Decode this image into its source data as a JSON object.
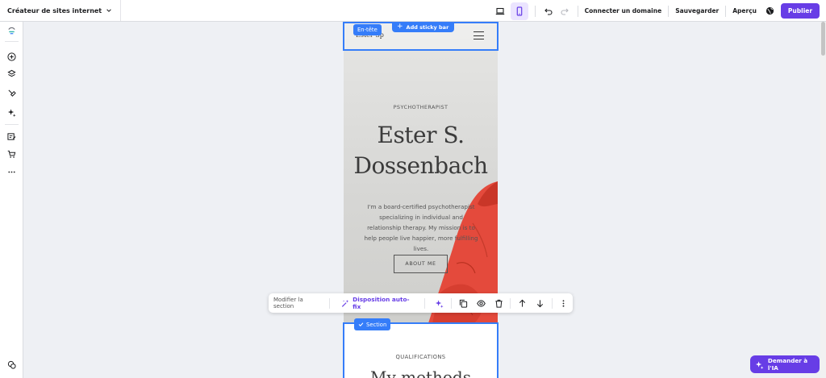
{
  "topbar": {
    "site_builder_label": "Créateur de sites internet",
    "connect_domain": "Connecter un domaine",
    "save": "Sauvegarder",
    "preview": "Aperçu",
    "publish": "Publier"
  },
  "canvas": {
    "header": {
      "logo_text": "Ester Sp"
    },
    "hero": {
      "kicker": "PSYCHOTHERAPIST",
      "name_line1": "Ester S.",
      "name_line2": "Dossenbach",
      "desc_l1": "I'm a board-certified psychotherapist",
      "desc_l2": "specializing in individual and",
      "desc_l3": "relationship therapy. My mission is to",
      "desc_l4": "help people live happier, more fulfilling",
      "desc_l5": "lives.",
      "button": "ABOUT ME"
    },
    "section2": {
      "kicker": "QUALIFICATIONS",
      "title": "My methods"
    }
  },
  "overlays": {
    "header_tag": "En-tête",
    "add_sticky_bar": "Add sticky bar",
    "section_tag": "Section"
  },
  "section_toolbar": {
    "edit_label": "Modifier la section",
    "autofix_label": "Disposition auto-fix"
  },
  "ai_button": "Demander à l'IA",
  "colors": {
    "accent": "#673de6",
    "selection": "#357df9"
  }
}
